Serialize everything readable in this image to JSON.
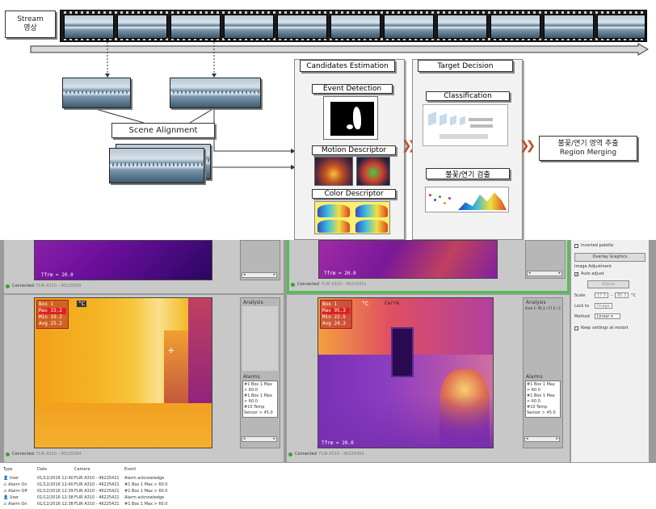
{
  "diagram": {
    "stream_label": [
      "Stream",
      "영상"
    ],
    "scene_alignment": "Scene Alignment",
    "candidates_estimation": "Candidates Estimation",
    "event_detection": "Event Detection",
    "motion_descriptor": "Motion Descriptor",
    "color_descriptor": "Color Descriptor",
    "target_decision": "Target Decision",
    "classification": "Classification",
    "fire_smoke_detection": "불꽃/연기 검출",
    "region_merging": [
      "불꽃/연기 영역 추출",
      "Region Merging"
    ]
  },
  "viewer": {
    "connected": "Connected",
    "tfrm_label": "Tfrm = 20.0",
    "analysis_label": "Analysis",
    "alarms_label": "Alarms",
    "cameras": [
      {
        "serial": "FLIR A310 - 46225630"
      },
      {
        "serial": "FLIR A310 - 46225421"
      },
      {
        "serial": "FLIR A310 - 46225584",
        "box": [
          "Box 1",
          "Max",
          "33.2",
          "Min",
          "19.2",
          "Avg",
          "25.2"
        ],
        "unit": "°C",
        "alarms": [
          "#1 Box 1 Max > 60.0",
          "#1 Box 1 Max > 60.0",
          "#10 Temp Sensor > 45.0"
        ]
      },
      {
        "serial": "FLIR A310 - 46225450",
        "box": [
          "Box 1",
          "Max",
          "95.3",
          "Min",
          "22.5",
          "Avg",
          "24.3"
        ],
        "unit": "°C",
        "tag": "Carré",
        "area": "Area 1: 95.3 / 17.5 / 24.3 °C",
        "alarms": [
          "#1 Box 1 Max > 60.0",
          "#1 Box 1 Max > 60.0",
          "#10 Temp Sensor > 45.0"
        ]
      }
    ]
  },
  "settings": {
    "inverted_palette": "Inverted palette",
    "overlay_graphics": "Overlay Graphics",
    "image_adjustment": "Image Adjustment",
    "auto_adjust": "Auto adjust",
    "adjust": "Adjust",
    "scale_label": "Scale",
    "scale_min": "17.5",
    "scale_max": "95.3",
    "scale_unit": "°C",
    "lock_label": "Lock to",
    "lock_value": "Image",
    "method_label": "Method",
    "method_value": "Linear",
    "keep_settings": "Keep settings at restart"
  },
  "log": {
    "headers": [
      "Type",
      "Date",
      "Camera",
      "Event"
    ],
    "rows": [
      [
        "User",
        "01/12/2016 12:40",
        "FLIR A310 - 46225421",
        "Alarm acknowledge"
      ],
      [
        "Alarm On",
        "01/12/2016 12:40",
        "FLIR A310 - 46225421",
        "#1 Box 1 Max > 60.0"
      ],
      [
        "Alarm Off",
        "01/12/2016 12:39",
        "FLIR A310 - 46225421",
        "#1 Box 1 Max > 60.0"
      ],
      [
        "User",
        "01/12/2016 12:38",
        "FLIR A310 - 46225421",
        "Alarm acknowledge"
      ],
      [
        "Alarm On",
        "01/12/2016 12:38",
        "FLIR A310 - 46225421",
        "#1 Box 1 Max > 60.0"
      ]
    ]
  }
}
